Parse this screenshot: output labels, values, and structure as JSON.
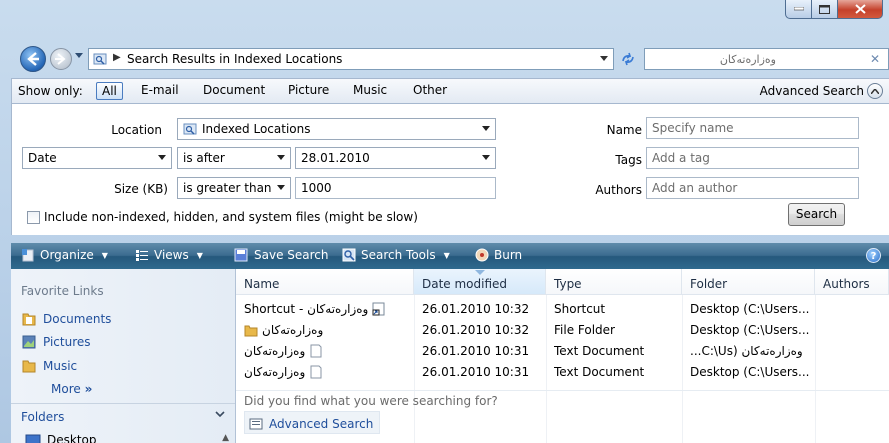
{
  "address": {
    "crumb": "Search Results in Indexed Locations",
    "search_query": "وەزارەتەکان"
  },
  "show_only": {
    "label": "Show only:",
    "filters": [
      "All",
      "E-mail",
      "Document",
      "Picture",
      "Music",
      "Other"
    ],
    "selected": "All",
    "advanced_label": "Advanced Search"
  },
  "advanced": {
    "location_label": "Location",
    "location_value": "Indexed Locations",
    "date_field": "Date",
    "date_operator": "is after",
    "date_value": "28.01.2010",
    "size_label": "Size (KB)",
    "size_operator": "is greater than",
    "size_value": "1000",
    "include_label": "Include non-indexed, hidden, and system files (might be slow)",
    "name_label": "Name",
    "name_placeholder": "Specify name",
    "tags_label": "Tags",
    "tags_placeholder": "Add a tag",
    "authors_label": "Authors",
    "authors_placeholder": "Add an author",
    "search_button": "Search"
  },
  "toolbar": {
    "organize": "Organize",
    "views": "Views",
    "save_search": "Save Search",
    "search_tools": "Search Tools",
    "burn": "Burn",
    "help": "?"
  },
  "nav": {
    "favorite_links_title": "Favorite Links",
    "links": [
      "Documents",
      "Pictures",
      "Music"
    ],
    "more": "More",
    "folders": "Folders",
    "tree_first": "Desktop"
  },
  "list": {
    "columns": [
      "Name",
      "Date modified",
      "Type",
      "Folder",
      "Authors"
    ],
    "rows": [
      {
        "name": "وەزارەتەکان - Shortcut",
        "date": "26.01.2010 10:32",
        "type": "Shortcut",
        "folder": "Desktop (C:\\Users...",
        "icon": "shortcut-icon"
      },
      {
        "name": "وەزارەتەکان",
        "date": "26.01.2010 10:32",
        "type": "File Folder",
        "folder": "Desktop (C:\\Users...",
        "icon": "folder-icon"
      },
      {
        "name": "وەزارەتەکان",
        "date": "26.01.2010 10:31",
        "type": "Text Document",
        "folder": "وەزارەتەکان (C:\\Us...",
        "icon": "text-document-icon"
      },
      {
        "name": "وەزارەتەکان",
        "date": "26.01.2010 10:31",
        "type": "Text Document",
        "folder": "Desktop (C:\\Users...",
        "icon": "text-document-icon"
      }
    ],
    "found_prompt": "Did you find what you were searching for?",
    "advanced_search_link": "Advanced Search"
  },
  "colors": {
    "toolbar_top": "#5f8cab",
    "toolbar_bottom": "#25587c",
    "link_blue": "#1f4e9b",
    "frame": "#b9d0e8",
    "close_red": "#c5412b"
  }
}
